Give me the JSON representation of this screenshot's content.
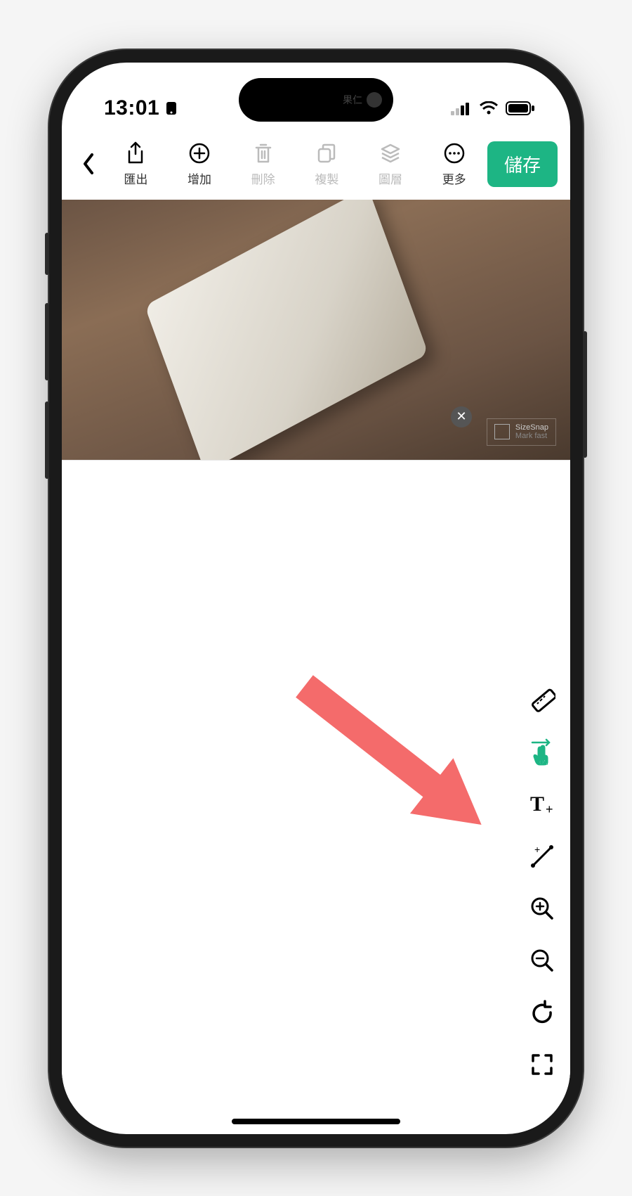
{
  "status_bar": {
    "time": "13:01",
    "island_name": "果仁"
  },
  "toolbar": {
    "export_label": "匯出",
    "add_label": "增加",
    "delete_label": "刪除",
    "copy_label": "複製",
    "layers_label": "圖層",
    "more_label": "更多",
    "save_label": "儲存"
  },
  "watermark": {
    "title": "SizeSnap",
    "subtitle": "Mark fast"
  },
  "side_tools": {
    "ruler": "ruler",
    "touch_on": "ON",
    "text": "T+",
    "line": "line+",
    "zoom_in": "zoom-in",
    "zoom_out": "zoom-out",
    "rotate": "rotate",
    "fullscreen": "fullscreen"
  },
  "colors": {
    "accent": "#1db584",
    "arrow": "#f46b6b"
  }
}
